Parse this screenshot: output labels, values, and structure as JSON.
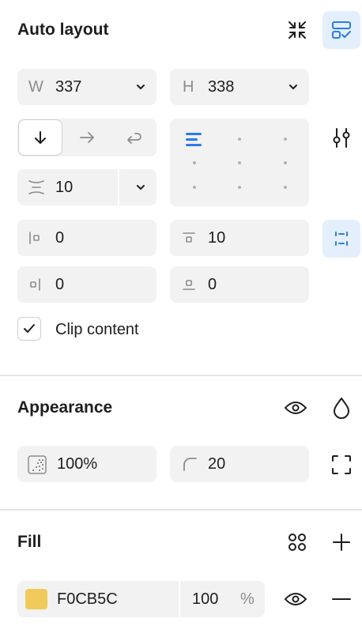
{
  "auto_layout": {
    "title": "Auto layout",
    "width": {
      "prefix": "W",
      "value": "337"
    },
    "height": {
      "prefix": "H",
      "value": "338"
    },
    "gap": {
      "value": "10"
    },
    "padding_left": {
      "value": "0"
    },
    "padding_top": {
      "value": "10"
    },
    "padding_right": {
      "value": "0"
    },
    "padding_bottom": {
      "value": "0"
    },
    "clip_content": {
      "label": "Clip content",
      "checked": true
    }
  },
  "appearance": {
    "title": "Appearance",
    "opacity": {
      "value": "100%"
    },
    "corner_radius": {
      "value": "20"
    }
  },
  "fill": {
    "title": "Fill",
    "hex": "F0CB5C",
    "swatch_color": "#F0CB5C",
    "opacity": "100",
    "opacity_unit": "%"
  },
  "colors": {
    "accent": "#2c7be5",
    "accent_bg": "#e3effc"
  }
}
